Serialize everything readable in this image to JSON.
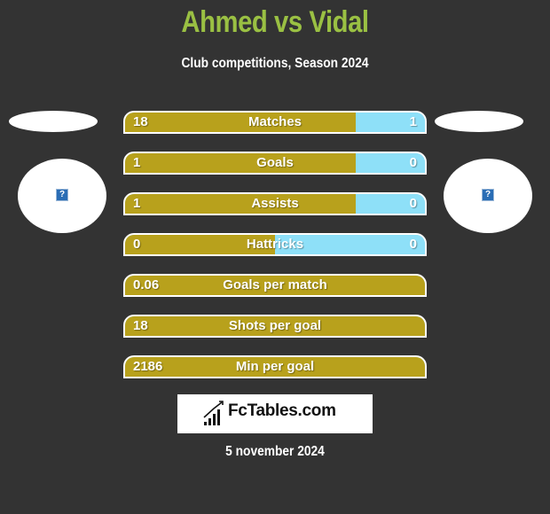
{
  "header": {
    "title": "Ahmed vs Vidal",
    "subtitle": "Club competitions, Season 2024"
  },
  "colors": {
    "background": "#333333",
    "title": "#9ac043",
    "left_bar": "#b8a11c",
    "right_bar": "#8ee0f8"
  },
  "players": {
    "left": {
      "name": "Ahmed",
      "logo_icon": "missing-image-icon"
    },
    "right": {
      "name": "Vidal",
      "logo_icon": "missing-image-icon"
    }
  },
  "chart_data": {
    "type": "bar",
    "title": "Ahmed vs Vidal",
    "subtitle": "Club competitions, Season 2024",
    "series": [
      {
        "name": "Ahmed",
        "color": "#b8a11c"
      },
      {
        "name": "Vidal",
        "color": "#8ee0f8"
      }
    ],
    "rows": [
      {
        "label": "Matches",
        "left": "18",
        "right": "1",
        "left_share": 0.77
      },
      {
        "label": "Goals",
        "left": "1",
        "right": "0",
        "left_share": 0.77
      },
      {
        "label": "Assists",
        "left": "1",
        "right": "0",
        "left_share": 0.77
      },
      {
        "label": "Hattricks",
        "left": "0",
        "right": "0",
        "left_share": 0.5
      },
      {
        "label": "Goals per match",
        "left": "0.06",
        "right": null,
        "left_share": 1.0
      },
      {
        "label": "Shots per goal",
        "left": "18",
        "right": null,
        "left_share": 1.0
      },
      {
        "label": "Min per goal",
        "left": "2186",
        "right": null,
        "left_share": 1.0
      }
    ]
  },
  "footer": {
    "brand": "FcTables.com",
    "brand_icon": "bar-chart-icon",
    "date": "5 november 2024"
  }
}
